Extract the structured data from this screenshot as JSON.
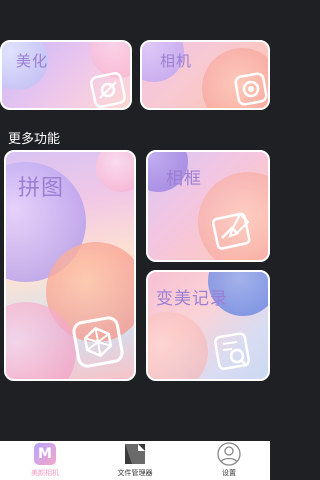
{
  "cards": {
    "beautify": {
      "label": "美化",
      "icon": "beautify-icon"
    },
    "camera": {
      "label": "相机",
      "icon": "camera-shutter-icon"
    },
    "collage": {
      "label": "拼图",
      "icon": "collage-grid-icon"
    },
    "frame": {
      "label": "相框",
      "icon": "frame-edit-icon"
    },
    "history": {
      "label": "变美记录",
      "icon": "history-search-icon"
    }
  },
  "section": {
    "more_features": "更多功能"
  },
  "bottom_nav": {
    "items": [
      {
        "label": "美颜相机",
        "icon": "app-logo-icon",
        "active": true
      },
      {
        "label": "文件管理器",
        "icon": "file-manager-icon",
        "active": false
      },
      {
        "label": "设置",
        "icon": "user-settings-icon",
        "active": false
      }
    ]
  },
  "colors": {
    "background": "#1f2024",
    "accent": "#f29ac3",
    "label": "#9b7fd4",
    "nav_background": "#ffffff"
  }
}
